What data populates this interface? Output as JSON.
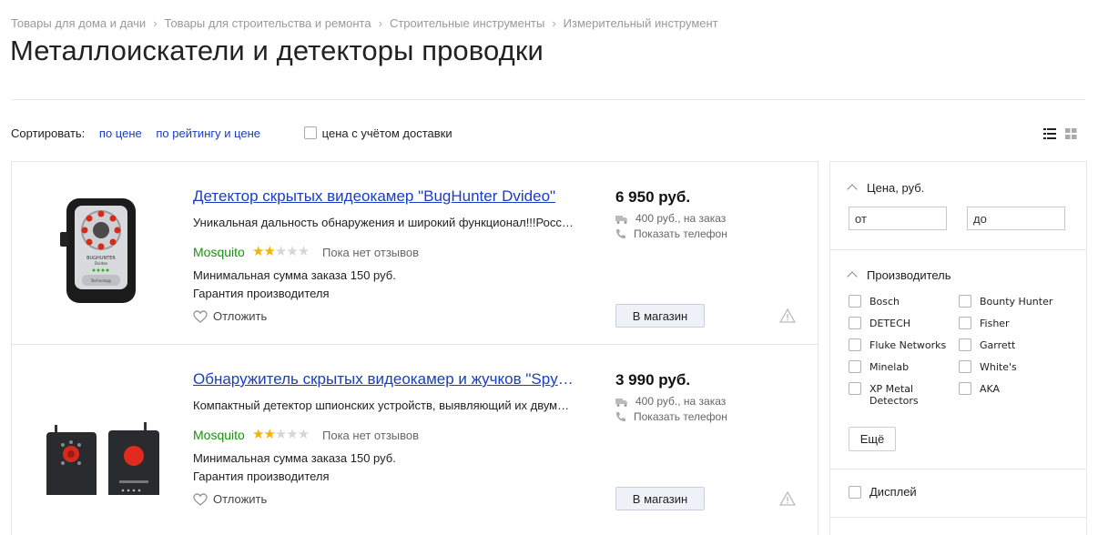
{
  "breadcrumbs": [
    "Товары для дома и дачи",
    "Товары для строительства и ремонта",
    "Строительные инструменты",
    "Измерительный инструмент"
  ],
  "page_title": "Металлоискатели и детекторы проводки",
  "sort": {
    "label": "Сортировать:",
    "by_price": "по цене",
    "by_rating_price": "по рейтингу и цене",
    "delivery_checkbox_label": "цена с учётом доставки"
  },
  "view_icons": [
    "list-view-icon",
    "grid-view-icon"
  ],
  "products": [
    {
      "name": "Детектор скрытых видеокамер \"BugHunter Dvideo\"",
      "description": "Уникальная дальность обнаружения и широкий функционал!!!Российская разработка",
      "shop": "Mosquito",
      "rating": 2,
      "reviews": "Пока нет отзывов",
      "min_order": "Минимальная сумма заказа 150 руб.",
      "warranty": "Гарантия производителя",
      "defer": "Отложить",
      "price": "6 950 руб.",
      "delivery": "400 руб., на заказ",
      "phone": "Показать телефон",
      "button": "В магазин",
      "image_text": [
        "BUGHUNTER",
        "Dvideo",
        "Technology"
      ]
    },
    {
      "name": "Обнаружитель скрытых видеокамер и жучков \"Spy Finder\"",
      "description": "Компактный детектор шпионских устройств, выявляющий их двумя способами",
      "shop": "Mosquito",
      "rating": 2,
      "reviews": "Пока нет отзывов",
      "min_order": "Минимальная сумма заказа 150 руб.",
      "warranty": "Гарантия производителя",
      "defer": "Отложить",
      "price": "3 990 руб.",
      "delivery": "400 руб., на заказ",
      "phone": "Показать телефон",
      "button": "В магазин"
    }
  ],
  "filters": {
    "price": {
      "title": "Цена, руб.",
      "from_placeholder": "от",
      "to_placeholder": "до"
    },
    "manufacturer": {
      "title": "Производитель",
      "left": [
        "Bosch",
        "DETECH",
        "Fluke Networks",
        "Minelab",
        "XP Metal Detectors"
      ],
      "right": [
        "Bounty Hunter",
        "Fisher",
        "Garrett",
        "White's",
        "AKA"
      ],
      "more": "Ещё"
    },
    "display": "Дисплей"
  },
  "colors": {
    "link": "#1a3dc1",
    "shop": "#169408",
    "star": "#f5b400"
  }
}
